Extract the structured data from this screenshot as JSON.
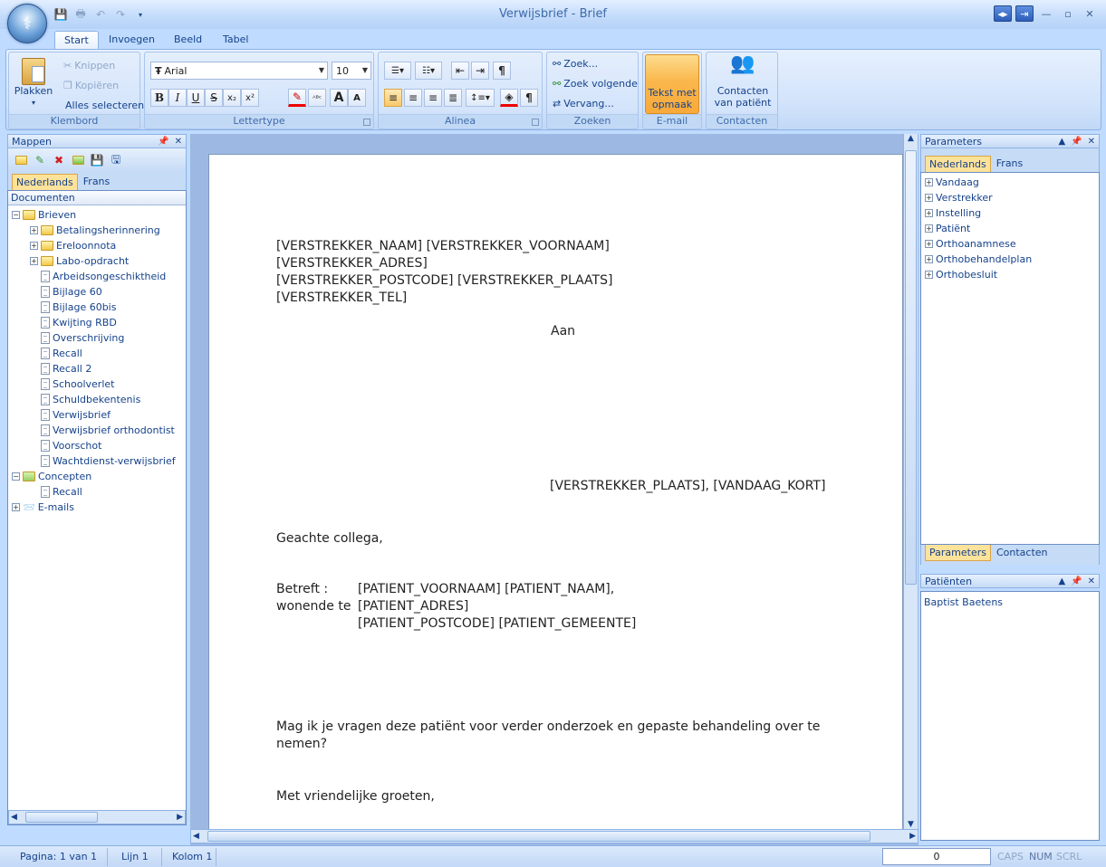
{
  "window": {
    "title": "Verwijsbrief - Brief"
  },
  "ribbon_tabs": [
    "Start",
    "Invoegen",
    "Beeld",
    "Tabel"
  ],
  "clipboard": {
    "paste": "Plakken",
    "cut": "Knippen",
    "copy": "Kopiëren",
    "select_all": "Alles selecteren",
    "label": "Klembord"
  },
  "font": {
    "family": "Arial",
    "size": "10",
    "label": "Lettertype"
  },
  "paragraph": {
    "label": "Alinea"
  },
  "search": {
    "find": "Zoek...",
    "find_next": "Zoek volgende",
    "replace": "Vervang...",
    "label": "Zoeken"
  },
  "email": {
    "button_line1": "Tekst met",
    "button_line2": "opmaak",
    "label": "E-mail"
  },
  "contacts": {
    "button_line1": "Contacten",
    "button_line2": "van patiënt",
    "label": "Contacten"
  },
  "left_pane": {
    "title": "Mappen",
    "tabs": [
      "Nederlands",
      "Frans"
    ],
    "header": "Documenten",
    "tree": [
      {
        "label": "Brieven",
        "type": "folder-open",
        "level": 0,
        "expander": "−"
      },
      {
        "label": "Betalingsherinnering",
        "type": "folder",
        "level": 1,
        "expander": "+"
      },
      {
        "label": "Ereloonnota",
        "type": "folder",
        "level": 1,
        "expander": "+"
      },
      {
        "label": "Labo-opdracht",
        "type": "folder",
        "level": 1,
        "expander": "+"
      },
      {
        "label": "Arbeidsongeschiktheid",
        "type": "doc",
        "level": 1
      },
      {
        "label": "Bijlage 60",
        "type": "doc",
        "level": 1
      },
      {
        "label": "Bijlage 60bis",
        "type": "doc",
        "level": 1
      },
      {
        "label": "Kwijting RBD",
        "type": "doc",
        "level": 1
      },
      {
        "label": "Overschrijving",
        "type": "doc",
        "level": 1
      },
      {
        "label": "Recall",
        "type": "doc",
        "level": 1
      },
      {
        "label": "Recall 2",
        "type": "doc",
        "level": 1
      },
      {
        "label": "Schoolverlet",
        "type": "doc",
        "level": 1
      },
      {
        "label": "Schuldbekentenis",
        "type": "doc",
        "level": 1
      },
      {
        "label": "Verwijsbrief",
        "type": "doc",
        "level": 1
      },
      {
        "label": "Verwijsbrief orthodontist",
        "type": "doc",
        "level": 1
      },
      {
        "label": "Voorschot",
        "type": "doc",
        "level": 1
      },
      {
        "label": "Wachtdienst-verwijsbrief",
        "type": "doc",
        "level": 1
      },
      {
        "label": "Concepten",
        "type": "folder-draft",
        "level": 0,
        "expander": "−"
      },
      {
        "label": "Recall",
        "type": "doc",
        "level": 1
      },
      {
        "label": "E-mails",
        "type": "email",
        "level": 0,
        "expander": "+"
      }
    ]
  },
  "document": {
    "sender_line1": "[VERSTREKKER_NAAM]  [VERSTREKKER_VOORNAAM]",
    "sender_line2": "[VERSTREKKER_ADRES]",
    "sender_line3": "[VERSTREKKER_POSTCODE] [VERSTREKKER_PLAATS]",
    "sender_line4": "[VERSTREKKER_TEL]",
    "recipient": "Aan",
    "place_date": "[VERSTREKKER_PLAATS], [VANDAAG_KORT]",
    "salutation": "Geachte collega,",
    "subject_label": "Betreft :",
    "living_label": "wonende te",
    "subject_line1": "[PATIENT_VOORNAAM] [PATIENT_NAAM],",
    "subject_line2": "[PATIENT_ADRES]",
    "subject_line3": "[PATIENT_POSTCODE] [PATIENT_GEMEENTE]",
    "body_line1": "Mag ik je vragen deze patiënt voor verder onderzoek en gepaste behandeling over te",
    "body_line2": "nemen?",
    "closing": "Met vriendelijke groeten,"
  },
  "right_pane": {
    "title": "Parameters",
    "tabs": [
      "Nederlands",
      "Frans"
    ],
    "items": [
      "Vandaag",
      "Verstrekker",
      "Instelling",
      "Patiënt",
      "Orthoanamnese",
      "Orthobehandelplan",
      "Orthobesluit"
    ],
    "bottom_tabs": [
      "Parameters",
      "Contacten"
    ]
  },
  "patients_pane": {
    "title": "Patiënten",
    "items": [
      "Baptist Baetens"
    ]
  },
  "status": {
    "page": "Pagina: 1 van 1",
    "line": "Lijn 1",
    "column": "Kolom 1",
    "value": "0",
    "caps": "CAPS",
    "num": "NUM",
    "scrl": "SCRL"
  }
}
